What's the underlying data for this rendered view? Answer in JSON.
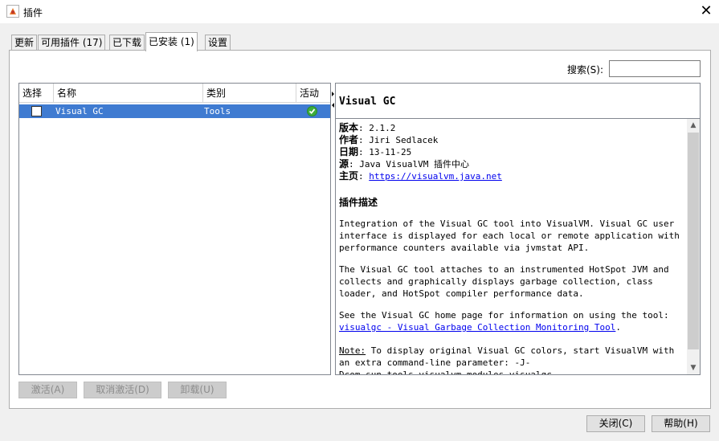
{
  "window": {
    "title": "插件",
    "close_glyph": "✕"
  },
  "tabs": [
    {
      "label": "更新",
      "selected": false
    },
    {
      "label": "可用插件 (17)",
      "selected": false
    },
    {
      "label": "已下载",
      "selected": false
    },
    {
      "label": "已安装 (1)",
      "selected": true
    },
    {
      "label": "设置",
      "selected": false
    }
  ],
  "search": {
    "label": "搜索(S):",
    "value": ""
  },
  "table": {
    "columns": [
      "选择",
      "名称",
      "类别",
      "活动"
    ],
    "rows": [
      {
        "name": "Visual GC",
        "category": "Tools",
        "checked": false,
        "active": true
      }
    ]
  },
  "detail": {
    "title": "Visual GC",
    "version_label": "版本",
    "version": "2.1.2",
    "author_label": "作者",
    "author": "Jiri Sedlacek",
    "date_label": "日期",
    "date": "13-11-25",
    "source_label": "源",
    "source": "Java VisualVM 插件中心",
    "homepage_label": "主页",
    "homepage": "https://visualvm.java.net",
    "description_heading": "插件描述",
    "paragraph1": "Integration of the Visual GC tool into VisualVM. Visual GC user interface is displayed for each local or remote application with performance counters available via jvmstat API.",
    "paragraph2": "The Visual GC tool attaches to an instrumented HotSpot JVM and collects and graphically displays garbage collection, class loader, and HotSpot compiler performance data.",
    "paragraph3_text": "See the Visual GC home page for information on using the tool: ",
    "paragraph3_link": "visualgc - Visual Garbage Collection Monitoring Tool",
    "paragraph3_end": ".",
    "note_label": "Note:",
    "note_text": " To display original Visual GC colors, start VisualVM with an extra command-line parameter: -J-Dcom.sun.tools.visualvm.modules.visualgc"
  },
  "buttons": {
    "activate": "激活(A)",
    "deactivate": "取消激活(D)",
    "uninstall": "卸载(U)",
    "close": "关闭(C)",
    "help": "帮助(H)"
  },
  "colors": {
    "selection": "#3f7bd1",
    "link": "#0000ee",
    "active_green": "#3dad3d"
  }
}
